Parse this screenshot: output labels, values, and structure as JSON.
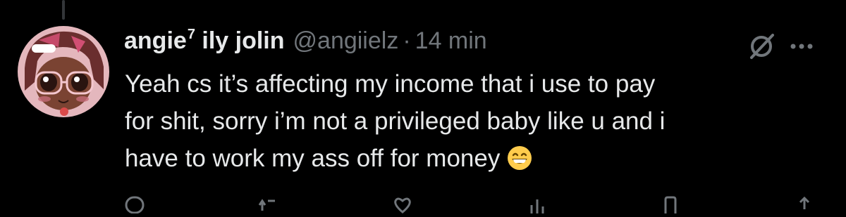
{
  "author": {
    "display_name": "angie",
    "name_superscript": "7",
    "name_suffix": " ily jolin",
    "handle": "@angiielz",
    "separator": "·",
    "timestamp": "14 min"
  },
  "tweet": {
    "lines": [
      "Yeah cs it’s affecting my income that i use to pay",
      "for shit, sorry i’m not a privileged baby like u and i",
      "have to work my ass off for money"
    ],
    "emoji": "grinning-face-with-smiling-eyes"
  },
  "icons": {
    "grok": "grok-icon",
    "more": "more-icon",
    "actions": [
      "reply-icon",
      "repost-icon",
      "like-icon",
      "views-icon",
      "bookmark-icon",
      "share-icon"
    ]
  },
  "colors": {
    "background": "#000000",
    "text": "#e7e9ea",
    "secondary": "#71767b",
    "avatar_bg": "#e4b7bd"
  }
}
